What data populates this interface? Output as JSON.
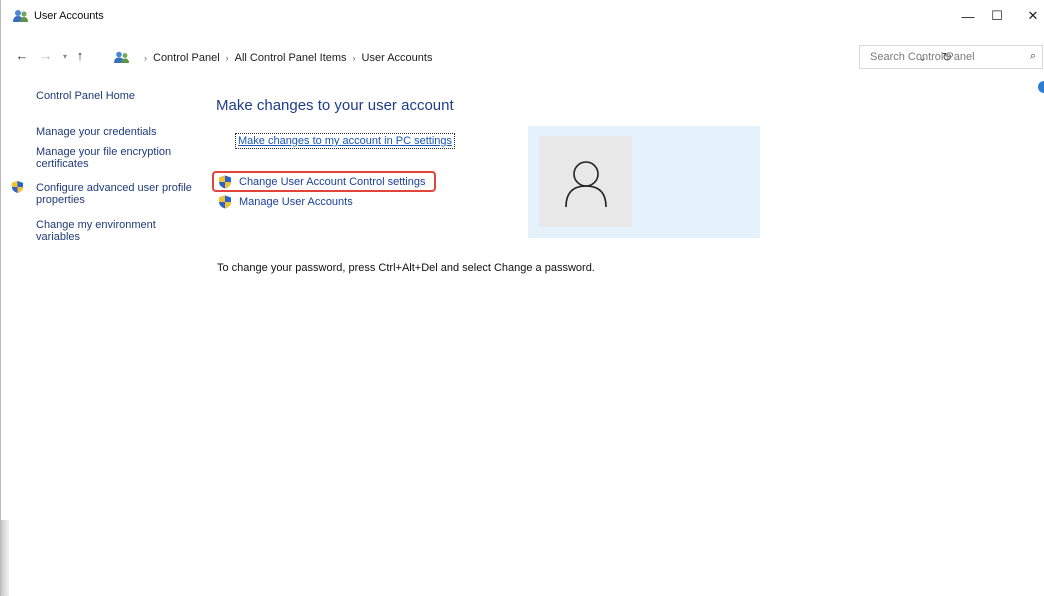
{
  "window": {
    "title": "User Accounts",
    "controls": {
      "minimize": "—",
      "maximize": "☐",
      "close": "✕"
    }
  },
  "address_bar": {
    "back": "←",
    "forward": "→",
    "recent": "▾",
    "up": "↑",
    "separator": "›",
    "crumbs": [
      "Control Panel",
      "All Control Panel Items",
      "User Accounts"
    ],
    "dropdown": "⌄",
    "refresh": "↻"
  },
  "search": {
    "placeholder": "Search Control Panel",
    "value": "",
    "icon_glyph": "⌕"
  },
  "left_pane": {
    "home": "Control Panel Home",
    "credentials": "Manage your credentials",
    "encryption": "Manage your file encryption certificates",
    "profile": "Configure advanced user profile properties",
    "environment": "Change my environment variables"
  },
  "main": {
    "title": "Make changes to your user account",
    "pc_settings_link": "Make changes to my account in PC settings",
    "tasks": {
      "uac": "Change User Account Control settings",
      "manage": "Manage User Accounts"
    },
    "password_note": "To change your password, press Ctrl+Alt+Del and select Change a password."
  },
  "colors": {
    "link": "#1f3a78",
    "title": "#1e3d8a",
    "highlight": "#e2433a",
    "tile": "#e5f1fb",
    "shield_blue": "#2a63c9",
    "shield_yellow": "#f2c230"
  }
}
